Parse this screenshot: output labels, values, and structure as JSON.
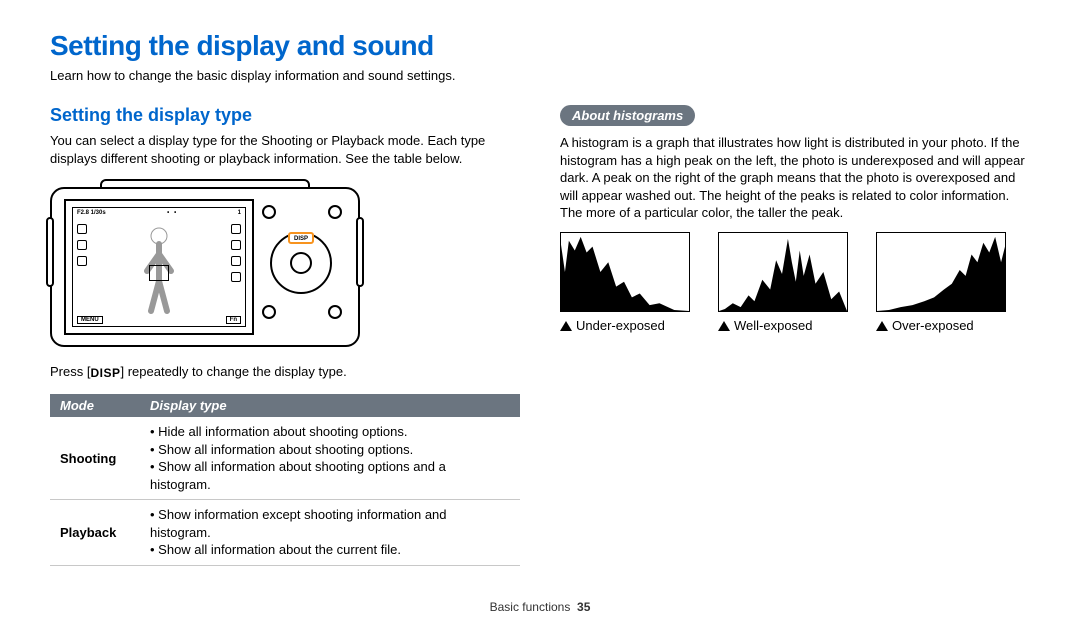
{
  "title": "Setting the display and sound",
  "subtitle": "Learn how to change the basic display information and sound settings.",
  "left": {
    "heading": "Setting the display type",
    "intro": "You can select a display type for the Shooting or Playback mode. Each type displays different shooting or playback information. See the table below.",
    "camera": {
      "exposure": "F2.8 1/30s",
      "topright": "1",
      "menu": "MENU",
      "fn": "Fn",
      "disp": "DISP"
    },
    "press_before": "Press [",
    "press_badge": "DISP",
    "press_after": "] repeatedly to change the display type.",
    "table": {
      "head": {
        "mode": "Mode",
        "type": "Display type"
      },
      "rows": [
        {
          "mode": "Shooting",
          "items": [
            "Hide all information about shooting options.",
            "Show all information about shooting options.",
            "Show all information about shooting options and a histogram."
          ]
        },
        {
          "mode": "Playback",
          "items": [
            "Show information except shooting information and histogram.",
            "Show all information about the current file."
          ]
        }
      ]
    }
  },
  "right": {
    "pill": "About histograms",
    "body": "A histogram is a graph that illustrates how light is distributed in your photo. If the histogram has a high peak on the left, the photo is underexposed and will appear dark. A peak on the right of the graph means that the photo is overexposed and will appear washed out. The height of the peaks is related to color information. The more of a particular color, the taller the peak.",
    "histograms": [
      {
        "label": "Under-exposed"
      },
      {
        "label": "Well-exposed"
      },
      {
        "label": "Over-exposed"
      }
    ]
  },
  "footer": {
    "section": "Basic functions",
    "page": "35"
  }
}
